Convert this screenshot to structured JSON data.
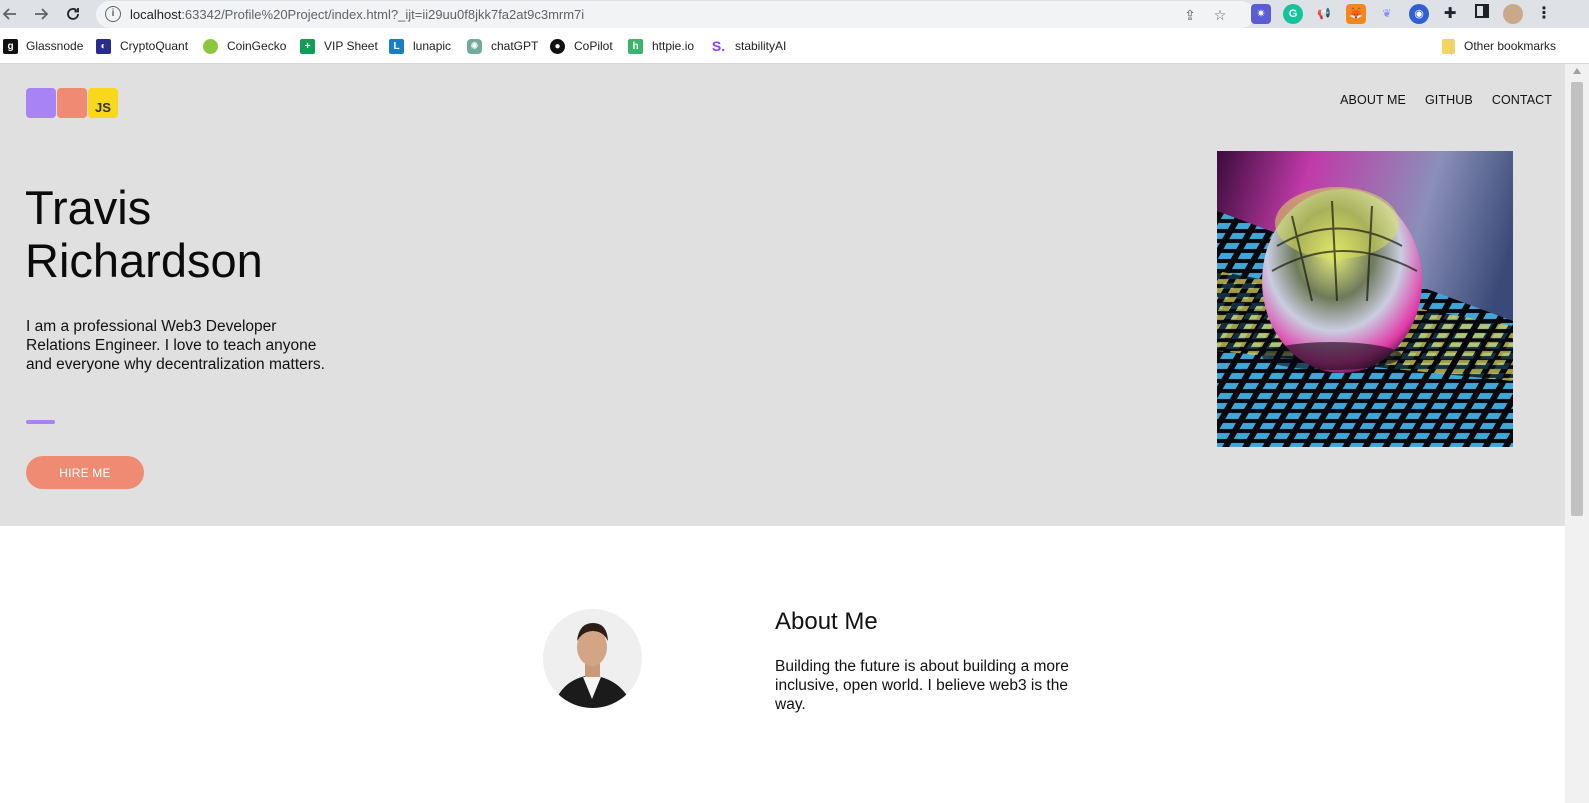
{
  "browser": {
    "url_host": "localhost",
    "url_rest": ":63342/Profile%20Project/index.html?_ijt=ii29uu0f8jkk7fa2at9c3mrm7i",
    "bookmarks": [
      {
        "label": "Glassnode",
        "icon": "glassnode-icon",
        "color": "#111111",
        "glyph": "g"
      },
      {
        "label": "CryptoQuant",
        "icon": "cryptoquant-icon",
        "color": "#2a2c8c",
        "glyph": "€"
      },
      {
        "label": "CoinGecko",
        "icon": "coingecko-icon",
        "color": "#8dc63f",
        "glyph": "●"
      },
      {
        "label": "VIP Sheet",
        "icon": "sheets-icon",
        "color": "#0f9d58",
        "glyph": "▦"
      },
      {
        "label": "lunapic",
        "icon": "lunapic-icon",
        "color": "#1a7fc1",
        "glyph": "L"
      },
      {
        "label": "chatGPT",
        "icon": "chatgpt-icon",
        "color": "#74aa9c",
        "glyph": "✺"
      },
      {
        "label": "CoPilot",
        "icon": "github-icon",
        "color": "#111111",
        "glyph": "●"
      },
      {
        "label": "httpie.io",
        "icon": "httpie-icon",
        "color": "#3bb56a",
        "glyph": "h"
      },
      {
        "label": "stabilityAI",
        "icon": "stabilityai-icon",
        "color": "#8b3dff",
        "glyph": "S"
      }
    ],
    "other_bookmarks": "Other bookmarks"
  },
  "page": {
    "logo_js": "JS",
    "nav": [
      "ABOUT ME",
      "GITHUB",
      "CONTACT"
    ],
    "hero": {
      "title": "Travis Richardson",
      "description": "I am a professional Web3 Developer Relations Engineer. I love to teach anyone and everyone why decentralization matters.",
      "button": "HIRE ME"
    },
    "about": {
      "title": "About Me",
      "description": "Building the future is about building a more inclusive, open world. I believe web3 is the way."
    }
  },
  "colors": {
    "purple": "#a783f5",
    "coral": "#ef8b73",
    "yellow": "#f8d81c",
    "hero_bg": "#e0e0e0"
  }
}
